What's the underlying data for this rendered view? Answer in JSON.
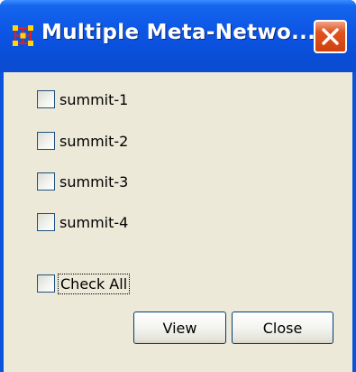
{
  "window": {
    "title": "Multiple Meta-Netwo..."
  },
  "icons": {
    "app": "network-grid-icon",
    "close": "close-icon"
  },
  "checkboxes": [
    {
      "label": "summit-1",
      "checked": false
    },
    {
      "label": "summit-2",
      "checked": false
    },
    {
      "label": "summit-3",
      "checked": false
    },
    {
      "label": "summit-4",
      "checked": false
    }
  ],
  "check_all": {
    "label": "Check All",
    "checked": false,
    "focused": true
  },
  "buttons": {
    "view_label": "View",
    "close_label": "Close"
  },
  "colors": {
    "titlebar": "#0a53dc",
    "close_button": "#e0531e",
    "dialog_background": "#ece9d8"
  }
}
